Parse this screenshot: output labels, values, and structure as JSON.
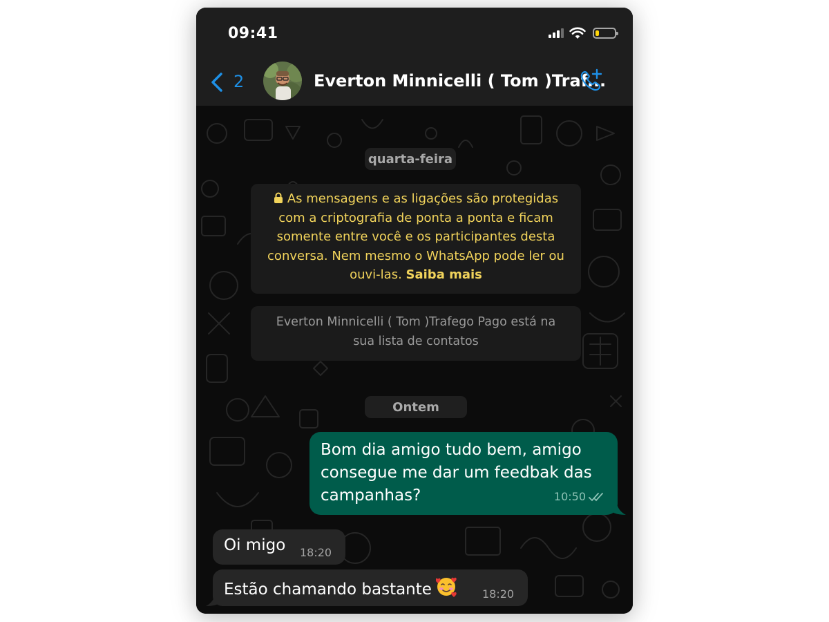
{
  "status_bar": {
    "time": "09:41"
  },
  "header": {
    "back_count": "2",
    "contact_name": "Everton Minnicelli ( Tom )Traf..."
  },
  "chat": {
    "date_1": "quarta-feira",
    "encryption_notice": {
      "text": "As mensagens e as ligações são protegidas com a criptografia de ponta a ponta e ficam somente entre você e os participantes desta conversa. Nem mesmo o WhatsApp pode ler ou ouvi-las.",
      "link": "Saiba mais"
    },
    "contact_notice": "Everton Minnicelli ( Tom )Trafego Pago está na sua lista de contatos",
    "date_2": "Ontem",
    "messages": [
      {
        "direction": "outgoing",
        "text": "Bom dia amigo tudo bem, amigo consegue me dar um feedbak das campanhas?",
        "time": "10:50",
        "status": "read"
      },
      {
        "direction": "incoming",
        "text": "Oi migo",
        "time": "18:20"
      },
      {
        "direction": "incoming",
        "text": "Estão chamando bastante",
        "emoji": "smiling-face-with-hearts",
        "time": "18:20"
      }
    ]
  },
  "colors": {
    "accent_blue": "#1e90e6",
    "outgoing_bubble": "#005c4b",
    "incoming_bubble": "#262626",
    "encryption_text": "#f1d35b",
    "battery_fill": "#ffd60a"
  },
  "icons": {
    "back": "chevron-left-icon",
    "call": "phone-plus-icon",
    "lock": "lock-icon",
    "read_receipt": "double-check-icon",
    "signal": "signal-icon",
    "wifi": "wifi-icon",
    "battery": "battery-icon"
  },
  "battery_level": 0.2
}
